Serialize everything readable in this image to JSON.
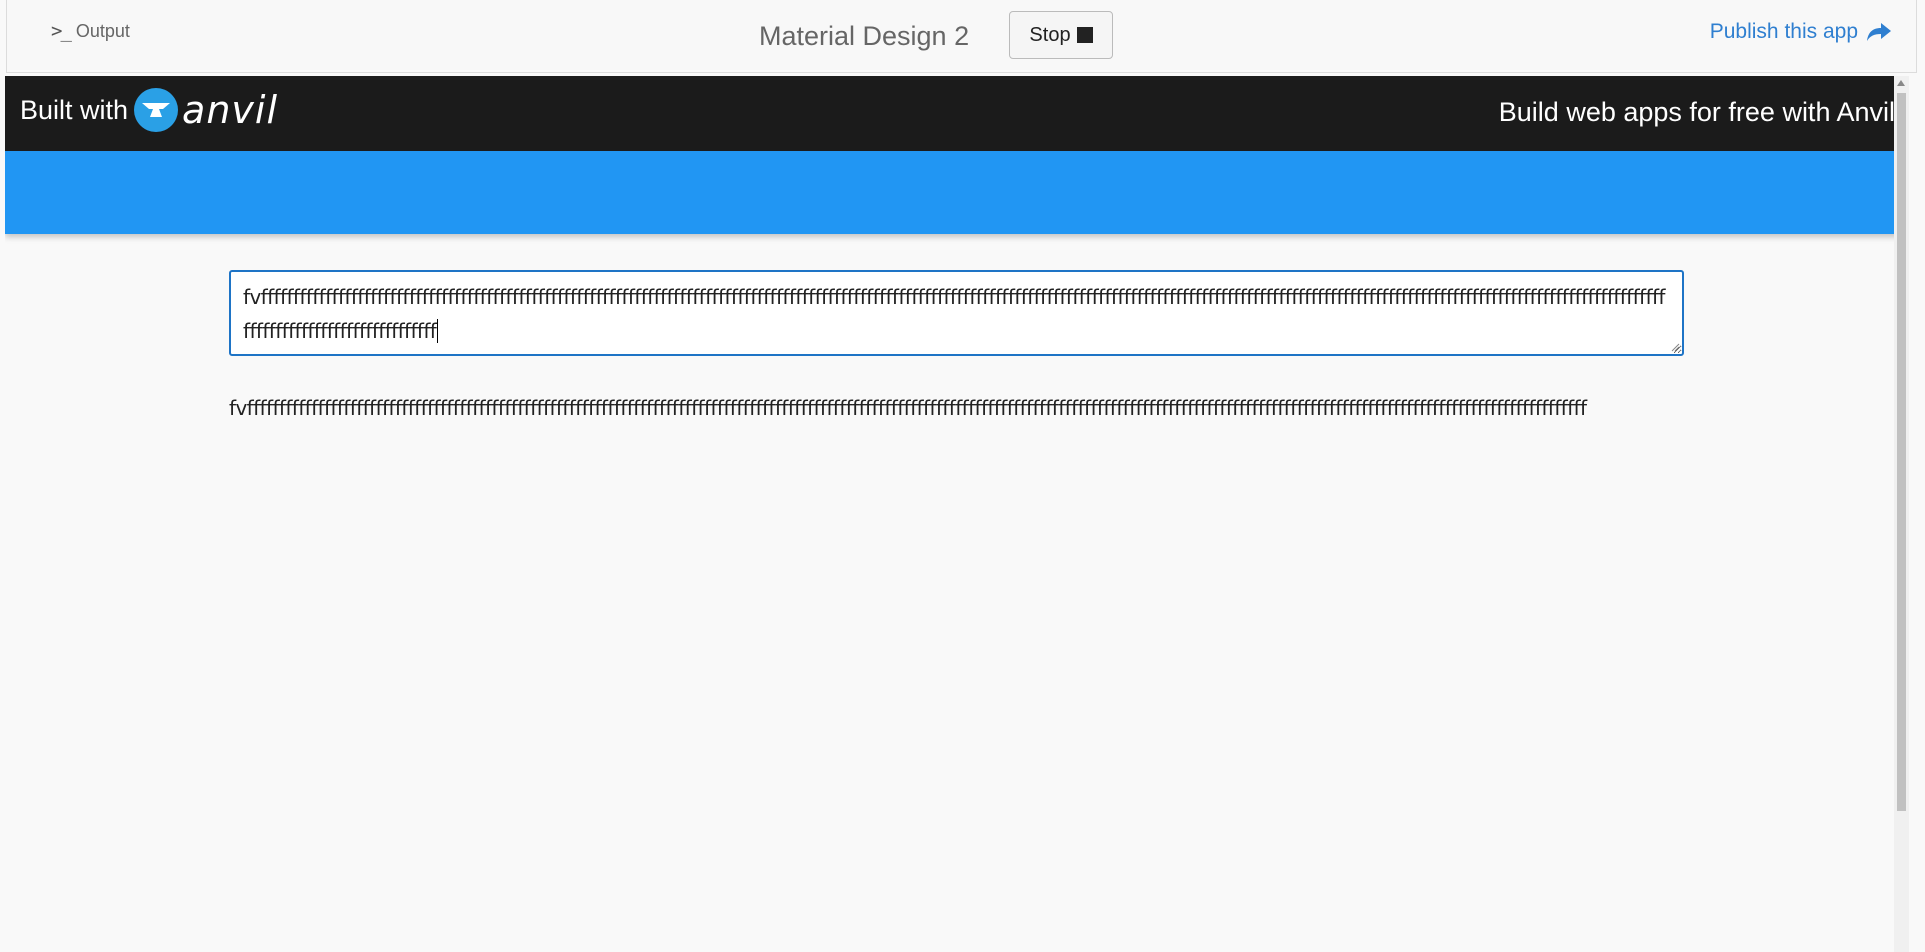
{
  "topbar": {
    "output_label": "Output",
    "app_title": "Material Design 2",
    "stop_label": "Stop",
    "publish_label": "Publish this app",
    "publish_color": "#2f7fd0"
  },
  "banner": {
    "built_with": "Built with",
    "logo_text": "anvil",
    "build_free_link": "Build web apps for free with Anvil",
    "banner_color": "#1b1b1b",
    "header_color": "#2196f3"
  },
  "main": {
    "text_area_value": "fvffffffffffffffffffffffffffffffffffffffffffffffffffffffffffffffffffffffffffffffffffffffffffffffffffffffffffffffffffffffffffffffffffffffffffffffffffffffffffffffffffffffffffffffffffffffffffffffffffffffffffffffffffffffffffffffffffffffffffffffffffffffff",
    "echo_label_text": "fvffffffffffffffffffffffffffffffffffffffffffffffffffffffffffffffffffffffffffffffffffffffffffffffffffffffffffffffffffffffffffffffffffffffffffffffffffffffffffffffffffffffffffffffffffffffffffffffffffffffffffffffff"
  }
}
